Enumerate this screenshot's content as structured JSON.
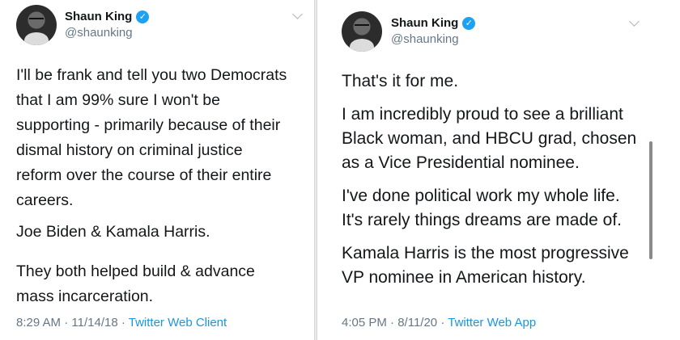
{
  "tweets": [
    {
      "author": {
        "display_name": "Shaun King",
        "handle": "@shaunking",
        "verified_icon": "verified-badge-icon",
        "verified_color": "#1da1f2"
      },
      "paragraphs": [
        [
          "I'll be frank and tell you two Democrats",
          "that I am 99% sure I won't be",
          "supporting - primarily because of their",
          "dismal history on criminal justice",
          "reform over the course of their entire",
          "careers."
        ],
        [
          "Joe Biden & Kamala Harris."
        ],
        [
          "They both helped build & advance",
          "mass incarceration."
        ]
      ],
      "time": "8:29 AM",
      "date": "11/14/18",
      "separator": "·",
      "source": "Twitter Web Client"
    },
    {
      "author": {
        "display_name": "Shaun King",
        "handle": "@shaunking",
        "verified_icon": "verified-badge-icon",
        "verified_color": "#1da1f2"
      },
      "paragraphs": [
        [
          "That's it for me."
        ],
        [
          "I am incredibly proud to see a brilliant",
          "Black woman, and HBCU grad, chosen",
          "as a Vice Presidential nominee."
        ],
        [
          "I've done political work my whole life.",
          "It's rarely things dreams are made of."
        ],
        [
          "Kamala Harris is the most progressive",
          "VP nominee in American history."
        ]
      ],
      "time": "4:05 PM",
      "date": "8/11/20",
      "separator": "·",
      "source": "Twitter Web App"
    }
  ],
  "colors": {
    "text": "#14171a",
    "secondary": "#657786",
    "link": "#1b95e0"
  }
}
